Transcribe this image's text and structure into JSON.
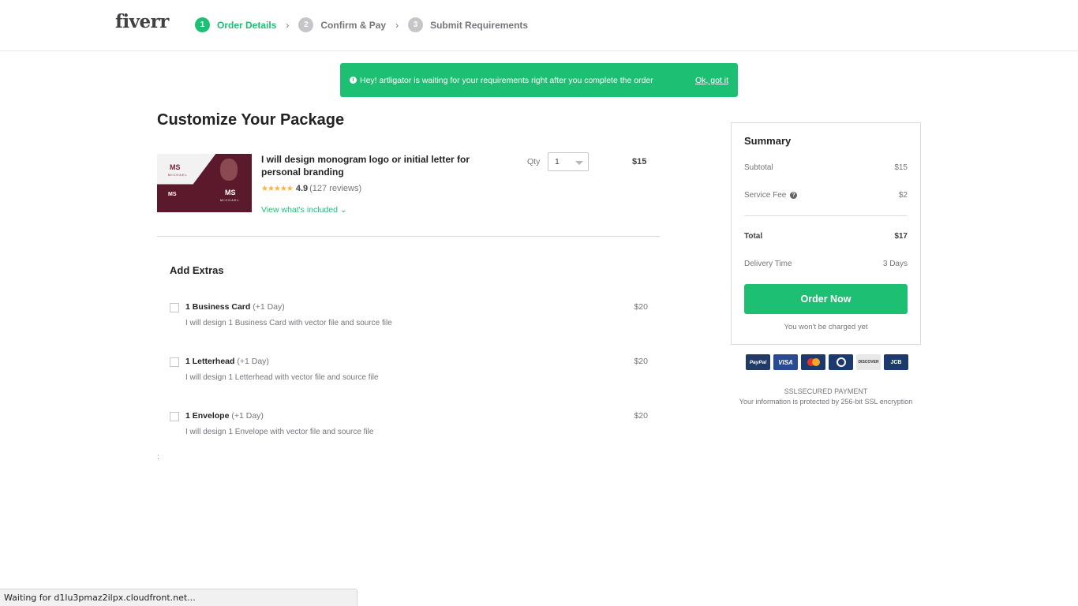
{
  "header": {
    "logo": "fiverr",
    "steps": [
      {
        "num": "1",
        "label": "Order Details",
        "active": true
      },
      {
        "num": "2",
        "label": "Confirm & Pay",
        "active": false
      },
      {
        "num": "3",
        "label": "Submit Requirements",
        "active": false
      }
    ],
    "chevron": "›"
  },
  "banner": {
    "icon": "info-icon",
    "message": "Hey! artligator is waiting for your requirements right after you complete the order",
    "dismiss_label": "Ok, got it"
  },
  "page_title": "Customize Your Package",
  "gig": {
    "thumbnail_text": {
      "monogram": "MS",
      "name": "MICHAEL"
    },
    "title": "I will design monogram logo or initial letter for personal branding",
    "stars": "★★★★★",
    "rating": "4.9",
    "reviews": "(127 reviews)",
    "view_included": "View what's included ⌄",
    "qty_label": "Qty",
    "qty_value": "1",
    "price": "$15"
  },
  "extras": {
    "title": "Add Extras",
    "items": [
      {
        "name": "1 Business Card",
        "days": "(+1 Day)",
        "description": "I will design 1 Business Card with vector file and source file",
        "price": "$20",
        "checked": false
      },
      {
        "name": "1 Letterhead",
        "days": "(+1 Day)",
        "description": "I will design 1 Letterhead with vector file and source file",
        "price": "$20",
        "checked": false
      },
      {
        "name": "1 Envelope",
        "days": "(+1 Day)",
        "description": "I will design 1 Envelope with vector file and source file",
        "price": "$20",
        "checked": false
      }
    ]
  },
  "stray_text": ":",
  "summary": {
    "title": "Summary",
    "subtotal_label": "Subtotal",
    "subtotal_value": "$15",
    "service_fee_label": "Service Fee",
    "service_fee_value": "$2",
    "total_label": "Total",
    "total_value": "$17",
    "delivery_label": "Delivery Time",
    "delivery_value": "3 Days",
    "order_button": "Order Now",
    "no_charge_note": "You won't be charged yet"
  },
  "payment_cards": {
    "paypal": "PayPal",
    "visa": "VISA",
    "mastercard": "",
    "diners": "",
    "discover": "DISCOVER",
    "jcb": "JCB"
  },
  "ssl": {
    "title": "SSLSECURED PAYMENT",
    "description": "Your information is protected by 256-bit SSL encryption"
  },
  "status_bar": "Waiting for d1lu3pmaz2ilpx.cloudfront.net..."
}
